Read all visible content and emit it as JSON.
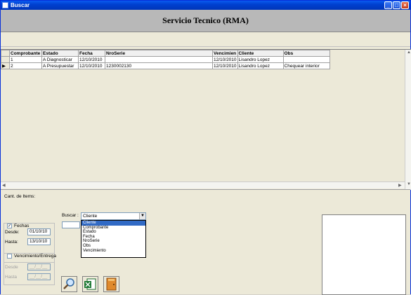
{
  "window": {
    "title": "Buscar"
  },
  "header": {
    "title": "Servicio Tecnico (RMA)"
  },
  "grid": {
    "columns": [
      "Comprobante",
      "Estado",
      "Fecha",
      "NroSerie",
      "Vencimien",
      "Cliente",
      "Obs"
    ],
    "rows": [
      [
        "1",
        "A Diagnosticar",
        "12/10/2010",
        "",
        "12/10/2010",
        "Lisandro Lopez",
        ""
      ],
      [
        "2",
        "A Presupuestar",
        "12/10/2010",
        "1230002130",
        "12/10/2010",
        "Lisandro Lopez",
        "Chequear interior"
      ]
    ]
  },
  "footer": {
    "count_label": "Cant. de Items:",
    "buscar_label": "Buscar :",
    "combo_value": "Cliente",
    "combo_options": [
      "Cliente",
      "Comprobante",
      "Estado",
      "Fecha",
      "NroSerie",
      "Obs",
      "Vencimiento"
    ],
    "fechas": {
      "label": "Fechas",
      "checked": true,
      "desde_label": "Desde:",
      "desde_value": "01/10/10",
      "hasta_label": "Hasta:",
      "hasta_value": "13/10/10"
    },
    "vencimiento": {
      "label": "Vencimiento/Entrega",
      "checked": false,
      "desde_label": "Desde",
      "desde_value": "__/__/__",
      "hasta_label": "Hasta",
      "hasta_value": "__/__/__"
    }
  },
  "icons": {
    "search": "magnifier-icon",
    "excel": "excel-export-icon",
    "exit": "exit-door-icon"
  },
  "colors": {
    "titlebar": "#0a5bf0",
    "selection": "#316ac5",
    "header_bg": "#b8b8b8"
  }
}
